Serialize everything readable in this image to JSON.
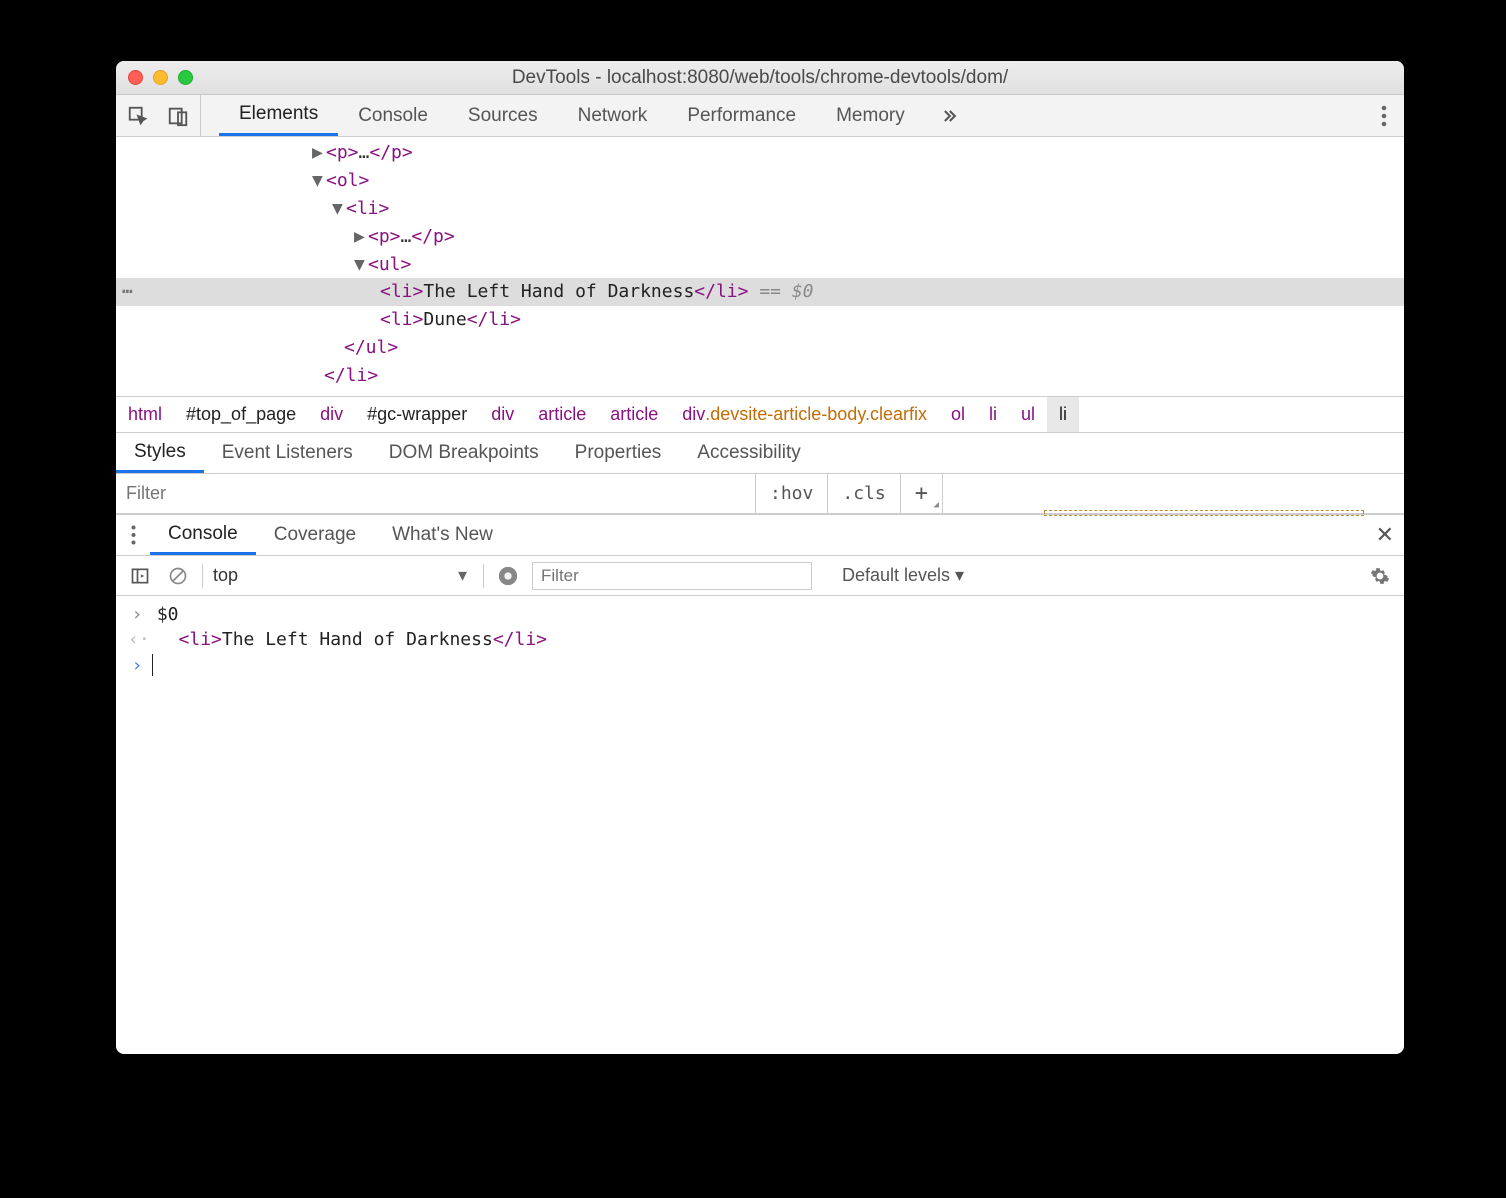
{
  "window": {
    "title": "DevTools - localhost:8080/web/tools/chrome-devtools/dom/"
  },
  "topTabs": [
    "Elements",
    "Console",
    "Sources",
    "Network",
    "Performance",
    "Memory"
  ],
  "topTabsActive": 0,
  "dom": {
    "line1": {
      "tagOpen": "<p>",
      "ell": "…",
      "tagClose": "</p>"
    },
    "line2": "<ol>",
    "line3": "<li>",
    "line4": {
      "tagOpen": "<p>",
      "ell": "…",
      "tagClose": "</p>"
    },
    "line5": "<ul>",
    "line6": {
      "tagOpen": "<li>",
      "text": "The Left Hand of Darkness",
      "tagClose": "</li>",
      "after": " == $0"
    },
    "line7": {
      "tagOpen": "<li>",
      "text": "Dune",
      "tagClose": "</li>"
    },
    "line8": "</ul>",
    "line9": "</li>"
  },
  "breadcrumbs": [
    {
      "label": "html",
      "style": "sel"
    },
    {
      "label": "#top_of_page",
      "style": "black"
    },
    {
      "label": "div",
      "style": "sel"
    },
    {
      "label": "#gc-wrapper",
      "style": "black"
    },
    {
      "label": "div",
      "style": "sel"
    },
    {
      "label": "article",
      "style": "sel"
    },
    {
      "label": "article",
      "style": "sel"
    },
    {
      "label": "div.devsite-article-body.clearfix",
      "style": "orange"
    },
    {
      "label": "ol",
      "style": "sel"
    },
    {
      "label": "li",
      "style": "sel"
    },
    {
      "label": "ul",
      "style": "sel"
    },
    {
      "label": "li",
      "style": "last"
    }
  ],
  "subTabs": [
    "Styles",
    "Event Listeners",
    "DOM Breakpoints",
    "Properties",
    "Accessibility"
  ],
  "subTabsActive": 0,
  "stylesFilter": {
    "placeholder": "Filter",
    "hov": ":hov",
    "cls": ".cls"
  },
  "drawerTabs": [
    "Console",
    "Coverage",
    "What's New"
  ],
  "drawerActive": 0,
  "consoleToolbar": {
    "context": "top",
    "filterPlaceholder": "Filter",
    "levels": "Default levels ▾"
  },
  "console": {
    "inputEcho": "$0",
    "resultTagOpen": "<li>",
    "resultText": "The Left Hand of Darkness",
    "resultTagClose": "</li>"
  }
}
